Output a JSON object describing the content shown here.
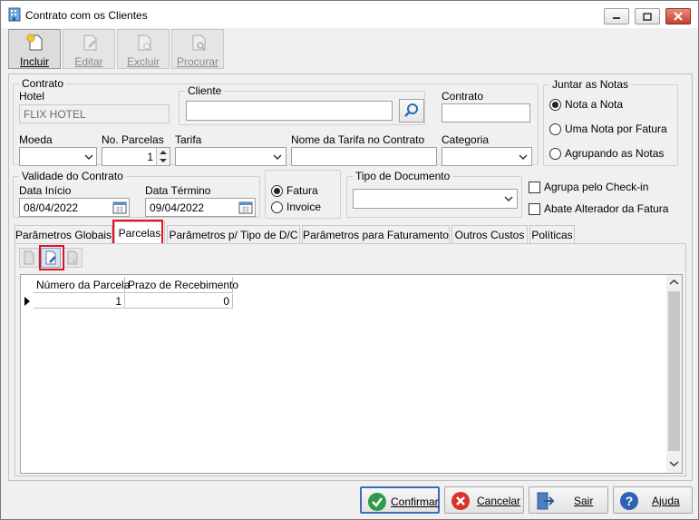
{
  "window": {
    "title": "Contrato com os Clientes"
  },
  "toolbar": {
    "incluir": "Incluir",
    "editar": "Editar",
    "excluir": "Excluir",
    "procurar": "Procurar"
  },
  "contrato_group": {
    "title": "Contrato",
    "hotel_label": "Hotel",
    "hotel_value": "FLIX HOTEL",
    "cliente_label": "Cliente",
    "cliente_value": "",
    "contrato_label": "Contrato",
    "contrato_value": "",
    "moeda_label": "Moeda",
    "moeda_value": "",
    "parcelas_label": "No. Parcelas",
    "parcelas_value": "1",
    "tarifa_label": "Tarifa",
    "tarifa_value": "",
    "nome_tarifa_label": "Nome da Tarifa no Contrato",
    "nome_tarifa_value": "",
    "categoria_label": "Categoria",
    "categoria_value": ""
  },
  "juntar_notas": {
    "title": "Juntar as Notas",
    "options": [
      "Nota a Nota",
      "Uma Nota por Fatura",
      "Agrupando as Notas"
    ],
    "selected": "Nota a Nota"
  },
  "validade": {
    "title": "Validade do Contrato",
    "inicio_label": "Data Início",
    "inicio_value": "08/04/2022",
    "termino_label": "Data Término",
    "termino_value": "09/04/2022"
  },
  "fatura_tipo": {
    "options": [
      "Fatura",
      "Invoice"
    ],
    "selected": "Fatura"
  },
  "tipo_documento": {
    "title": "Tipo de Documento",
    "value": ""
  },
  "checks": {
    "agrupa": "Agrupa pelo Check-in",
    "abate": "Abate Alterador da Fatura"
  },
  "tabs": [
    "Parâmetros Globais",
    "Parcelas",
    "Parâmetros p/ Tipo de D/C",
    "Parâmetros para Faturamento",
    "Outros Custos",
    "Políticas"
  ],
  "active_tab": "Parcelas",
  "grid": {
    "columns": [
      "Número da Parcela",
      "Prazo de Recebimento"
    ],
    "rows": [
      [
        "1",
        "0"
      ]
    ]
  },
  "buttons": {
    "confirmar": "Confirmar",
    "cancelar": "Cancelar",
    "sair": "Sair",
    "ajuda": "Ajuda"
  },
  "colors": {
    "highlight": "#e0141e",
    "accent": "#3a6fb7"
  }
}
